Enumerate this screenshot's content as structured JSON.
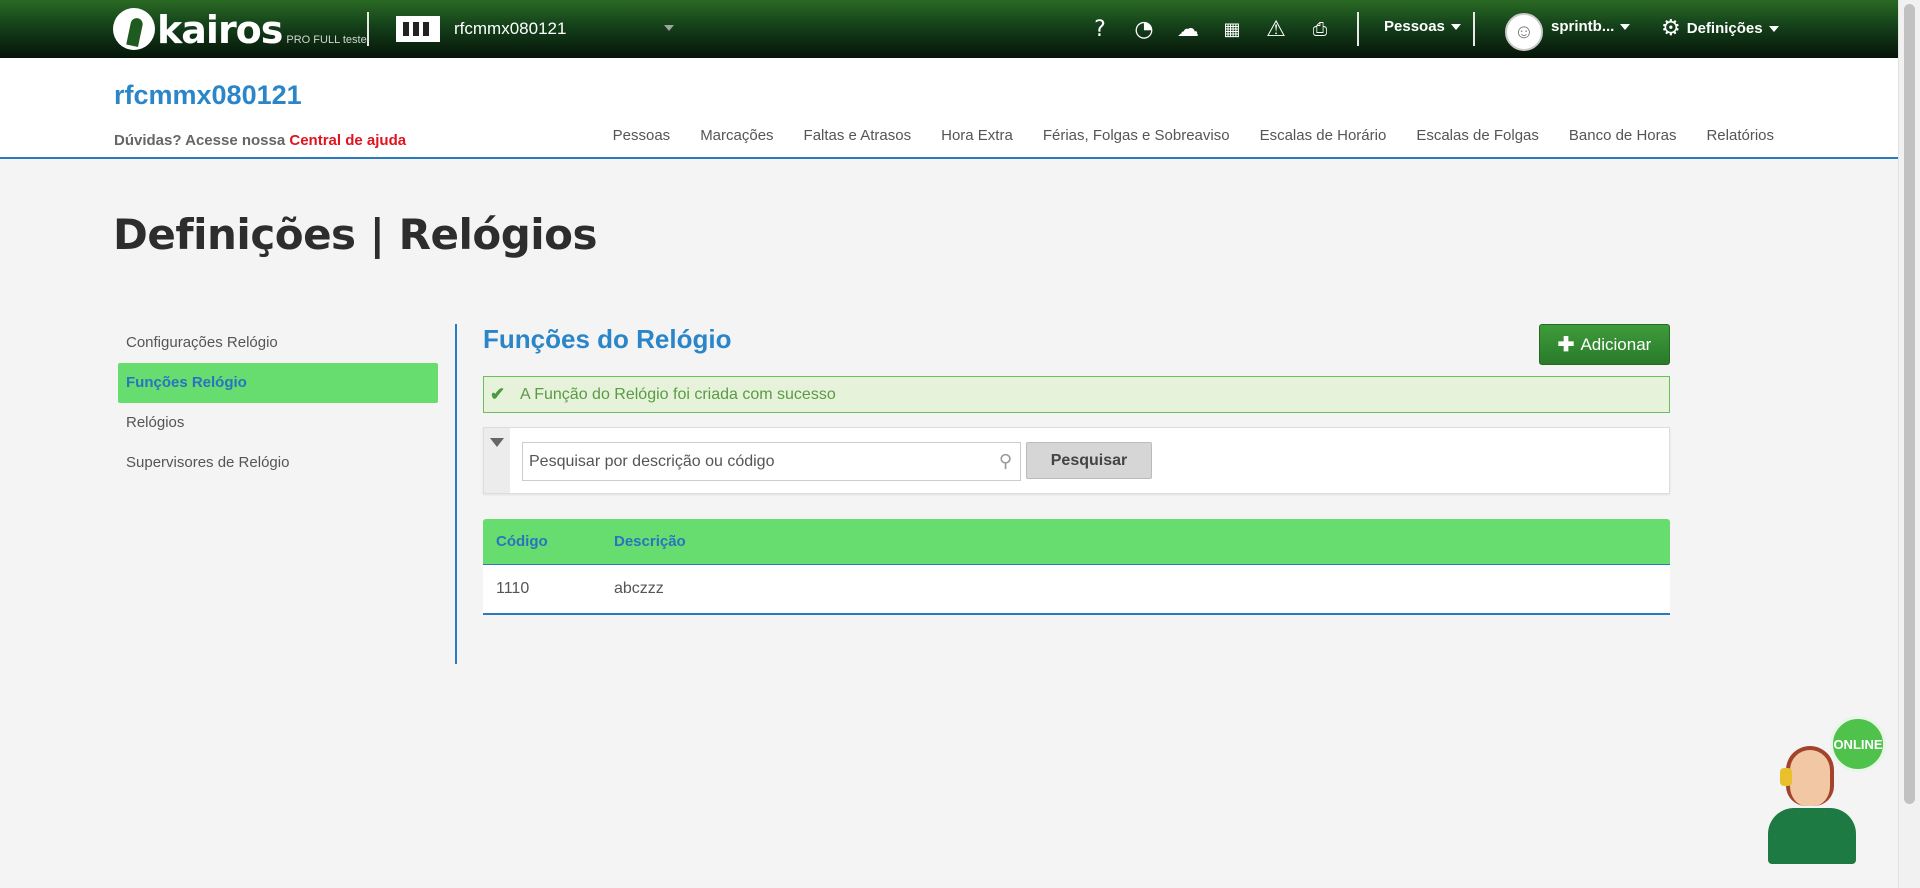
{
  "topbar": {
    "logo_text": "kairos",
    "logo_sub": "PRO FULL teste",
    "company": "rfcmmx080121",
    "icons": [
      "help-icon",
      "time-icon",
      "cloud-download-icon",
      "calculator-icon",
      "warning-icon",
      "inbox-icon"
    ],
    "people_menu": "Pessoas",
    "user_name": "sprintb...",
    "settings_menu": "Definições"
  },
  "header": {
    "company_title": "rfcmmx080121",
    "help_text": "Dúvidas? Acesse nossa",
    "help_link": "Central de ajuda",
    "nav": [
      "Pessoas",
      "Marcações",
      "Faltas e Atrasos",
      "Hora Extra",
      "Férias, Folgas e Sobreaviso",
      "Escalas de Horário",
      "Escalas de Folgas",
      "Banco de Horas",
      "Relatórios"
    ]
  },
  "page": {
    "title": "Definições | Relógios"
  },
  "sidemenu": {
    "items": [
      {
        "label": "Configurações Relógio"
      },
      {
        "label": "Funções Relógio",
        "active": true
      },
      {
        "label": "Relógios"
      },
      {
        "label": "Supervisores de Relógio"
      }
    ]
  },
  "content": {
    "section_title": "Funções do Relógio",
    "add_button": "Adicionar",
    "success_message": "A Função do Relógio foi criada com sucesso",
    "search": {
      "placeholder": "Pesquisar por descrição ou código",
      "value": "",
      "button": "Pesquisar"
    },
    "table": {
      "columns": [
        "Código",
        "Descrição"
      ],
      "rows": [
        [
          "1110",
          "abczzz"
        ]
      ]
    }
  },
  "chat": {
    "status": "ONLINE"
  },
  "colors": {
    "accent_blue": "#2a86c8",
    "active_green": "#66dd6e",
    "button_green": "#2f8a2f",
    "help_link_red": "#e0141e"
  }
}
